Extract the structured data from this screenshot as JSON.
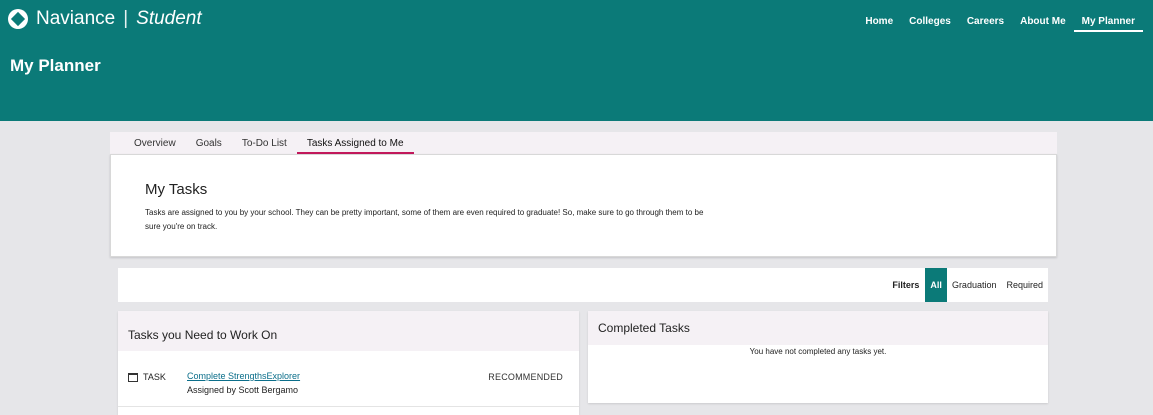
{
  "header": {
    "brand": "Naviance",
    "brand_separator": "|",
    "brand_sub": "Student",
    "page_title": "My Planner",
    "nav": [
      "Home",
      "Colleges",
      "Careers",
      "About Me",
      "My Planner"
    ],
    "active_nav": "My Planner",
    "bg_color": "#0b7a78"
  },
  "tabs": {
    "items": [
      "Overview",
      "Goals",
      "To-Do List",
      "Tasks Assigned to Me"
    ],
    "active": "Tasks Assigned to Me",
    "accent": "#c2185b"
  },
  "my_tasks": {
    "title": "My Tasks",
    "description": "Tasks are assigned to you by your school. They can be pretty important, some of them are even required to graduate! So, make sure to go through them to be sure you're on track."
  },
  "filters": {
    "label": "Filters",
    "options": [
      "All",
      "Graduation",
      "Required"
    ],
    "active": "All"
  },
  "work_on": {
    "title": "Tasks you Need to Work On",
    "tasks": [
      {
        "kind": "TASK",
        "title": "Complete StrengthsExplorer",
        "assigned_by": "Assigned by Scott Bergamo",
        "status": "RECOMMENDED"
      }
    ]
  },
  "completed": {
    "title": "Completed Tasks",
    "empty_text": "You have not completed any tasks yet."
  }
}
